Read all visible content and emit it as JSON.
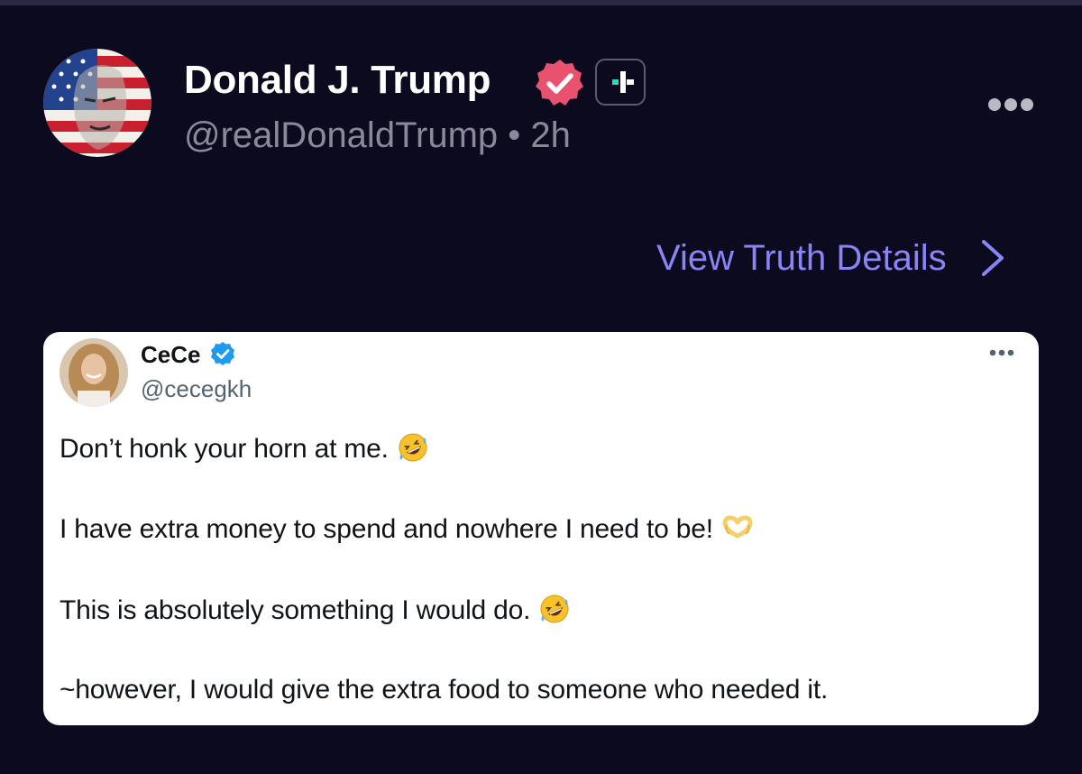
{
  "post": {
    "author_name": "Donald J. Trump",
    "author_handle": "@realDonaldTrump",
    "separator": "•",
    "time_ago": "2h",
    "view_details_label": "View Truth Details"
  },
  "embedded_tweet": {
    "name": "CeCe",
    "handle": "@cecegkh",
    "lines": [
      "Don’t honk your horn at me.",
      "I have extra money to spend and nowhere I need to be!",
      "This is absolutely something I would do.",
      "~however, I would give the extra food to someone who needed it."
    ]
  },
  "icons": {
    "verified": "verified-badge-icon",
    "plus": "plus-icon",
    "more": "more-horizontal-icon",
    "chevron": "chevron-right-icon",
    "rolling_laughing": "rolling-laughing-emoji",
    "heart_hands": "heart-hands-emoji"
  },
  "colors": {
    "background": "#0c0a1f",
    "link": "#8b84f5",
    "verified_pink": "#e8526e",
    "twitter_blue": "#1d9bf0",
    "muted": "#8a8899"
  }
}
